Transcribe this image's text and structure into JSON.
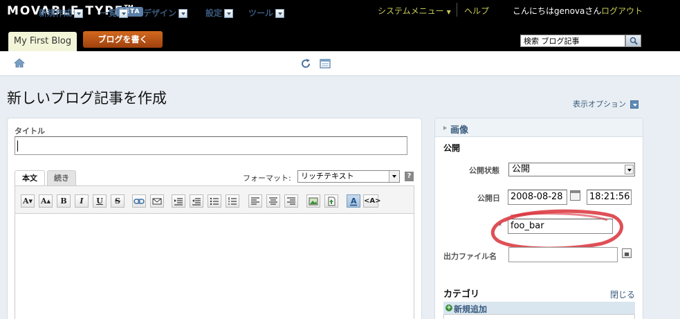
{
  "app": {
    "logo": "MOVABLE TYPE",
    "logo_tm": "TM",
    "badge": "BETA"
  },
  "header": {
    "system_menu": "システムメニュー",
    "help": "ヘルプ",
    "greeting": "こんにちはgenovaさん",
    "logout": "ログアウト",
    "blog_tab": "My First Blog",
    "write_button": "ブログを書く",
    "search_value": "検索 ブログ記事"
  },
  "nav": {
    "items": [
      {
        "label": "新規作成"
      },
      {
        "label": "一覧"
      },
      {
        "label": "デザイン"
      },
      {
        "label": "設定"
      },
      {
        "label": "ツール"
      }
    ]
  },
  "page": {
    "title": "新しいブログ記事を作成",
    "display_options": "表示オプション"
  },
  "editor": {
    "title_label": "タイトル",
    "tabs": [
      {
        "label": "本文"
      },
      {
        "label": "続き"
      }
    ],
    "format_label": "フォーマット:",
    "format_value": "リッチテキスト",
    "help": "?",
    "toolbar": {
      "font_smaller": "A▾",
      "font_larger": "A▴",
      "bold": "B",
      "italic": "I",
      "underline": "U",
      "strike": "S",
      "html_mode": "<A>"
    }
  },
  "sidebar": {
    "image_label": "画像",
    "publish_heading": "公開",
    "status_label": "公開状態",
    "status_value": "公開",
    "date_label": "公開日",
    "date_value": "2008-08-28",
    "time_value": "18:21:56",
    "basename_marker": "*",
    "basename_value": "foo_bar",
    "filename_label": "出力ファイル名",
    "category_heading": "カテゴリ",
    "close_link": "閉じる",
    "add_new": "新規追加"
  },
  "colors": {
    "header_bg": "#000000",
    "menu_link": "#c8cc55",
    "accent_button": "#c4561a",
    "nav_text": "#3a5b7e",
    "annotation_red": "#d9313a"
  }
}
